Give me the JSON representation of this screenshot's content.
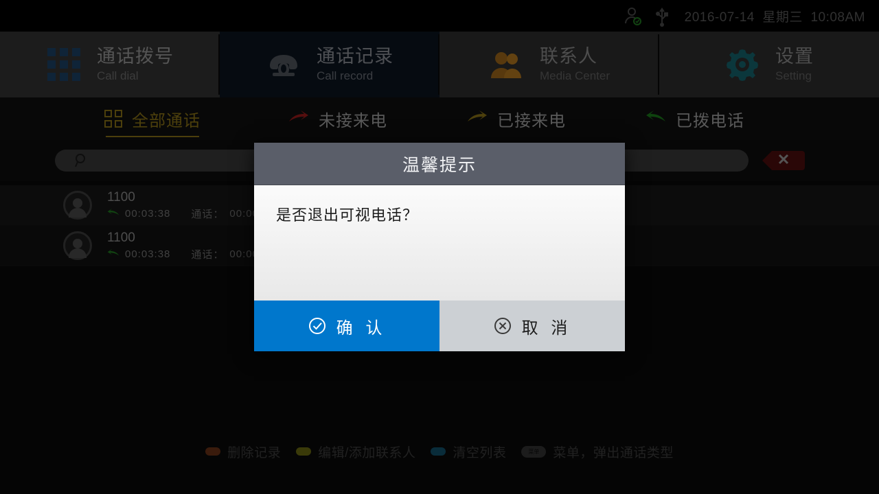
{
  "statusbar": {
    "user_icon": "user-online-icon",
    "usb_icon": "usb-icon",
    "datetime": "2016-07-14  星期三  10:08AM"
  },
  "tabs": [
    {
      "cn": "通话拨号",
      "en": "Call dial",
      "icon": "dialpad-icon",
      "state": "inactive"
    },
    {
      "cn": "通话记录",
      "en": "Call record",
      "icon": "telephone-icon",
      "state": "active"
    },
    {
      "cn": "联系人",
      "en": "Media Center",
      "icon": "contacts-icon",
      "state": "dimmed"
    },
    {
      "cn": "设置",
      "en": "Setting",
      "icon": "gear-icon",
      "state": "dimmed"
    }
  ],
  "filters": [
    {
      "label": "全部通话",
      "icon": "grid-squares-icon",
      "color": "#8a7416",
      "active": true
    },
    {
      "label": "未接来电",
      "icon": "arrow-missed-icon",
      "color": "#9b1b1b",
      "active": false
    },
    {
      "label": "已接来电",
      "icon": "arrow-received-icon",
      "color": "#8a7416",
      "active": false
    },
    {
      "label": "已拨电话",
      "icon": "arrow-dialed-icon",
      "color": "#1a7a1a",
      "active": false
    }
  ],
  "search": {
    "value": "",
    "placeholder": "",
    "icon": "search-icon"
  },
  "close_button": {
    "icon": "close-icon",
    "label": ""
  },
  "call_list": [
    {
      "number": "1100",
      "direction_icon": "arrow-dialed-icon",
      "time": "00:03:38",
      "duration_label": "通话：",
      "duration": "00:00:"
    },
    {
      "number": "1100",
      "direction_icon": "arrow-dialed-icon",
      "time": "00:03:38",
      "duration_label": "通话：",
      "duration": "00:00:"
    }
  ],
  "hints": [
    {
      "label": "删除记录",
      "color": "#6b3217",
      "type": "dot"
    },
    {
      "label": "编辑/添加联系人",
      "color": "#6b6b12",
      "type": "dot"
    },
    {
      "label": "清空列表",
      "color": "#12506b",
      "type": "dot"
    },
    {
      "label": "菜单，弹出通话类型",
      "color": "#333333",
      "type": "pill",
      "pill_text": "菜单"
    }
  ],
  "dialog": {
    "title": "温馨提示",
    "message": "是否退出可视电话？",
    "confirm": {
      "label": "确 认",
      "icon": "check-circle-icon",
      "color": "#0077cc"
    },
    "cancel": {
      "label": "取 消",
      "icon": "x-circle-icon",
      "color": "#ccd0d4"
    }
  }
}
